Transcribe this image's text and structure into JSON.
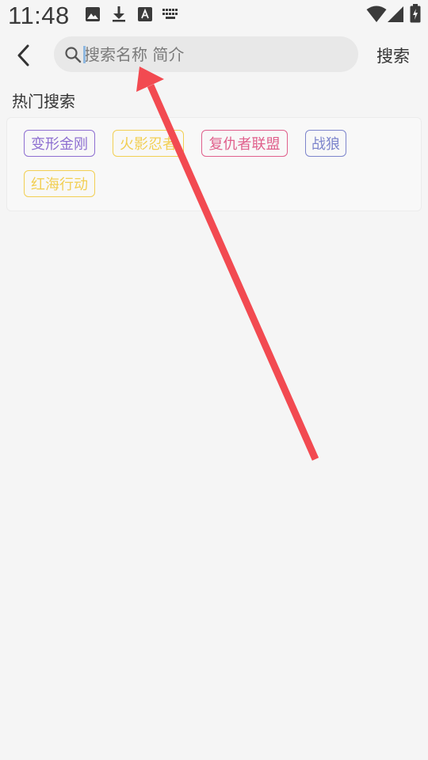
{
  "status_bar": {
    "time": "11:48",
    "icons": [
      "image-icon",
      "download-icon",
      "text-a-icon",
      "keyboard-icon",
      "wifi-icon",
      "signal-icon",
      "battery-icon"
    ]
  },
  "header": {
    "back_icon": "chevron-left-icon",
    "search": {
      "icon": "search-icon",
      "placeholder": "搜索名称 简介",
      "value": ""
    },
    "search_button_label": "搜索"
  },
  "hot_search": {
    "title": "热门搜索",
    "tags": [
      {
        "label": "变形金刚",
        "color": "#8e6fd1"
      },
      {
        "label": "火影忍者",
        "color": "#f2cf53"
      },
      {
        "label": "复仇者联盟",
        "color": "#e0608c"
      },
      {
        "label": "战狼",
        "color": "#7d85cc"
      },
      {
        "label": "红海行动",
        "color": "#f2cf53"
      }
    ]
  },
  "annotation": {
    "arrow_color": "#f24a51"
  }
}
